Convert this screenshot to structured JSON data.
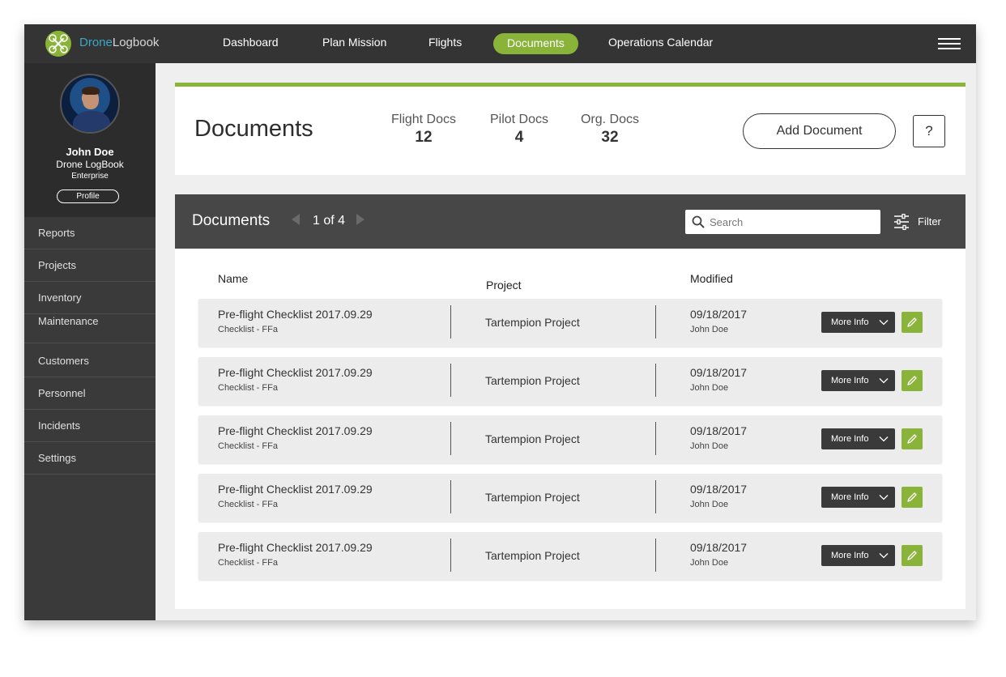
{
  "nav": {
    "brand_part1": "Drone",
    "brand_part2": "Logbook",
    "links": [
      {
        "label": "Dashboard",
        "active": false
      },
      {
        "label": "Plan Mission",
        "active": false
      },
      {
        "label": "Flights",
        "active": false
      },
      {
        "label": "Documents",
        "active": true
      },
      {
        "label": "Operations Calendar",
        "active": false
      }
    ],
    "menu_icon": "hamburger-icon"
  },
  "user": {
    "name": "John Doe",
    "org": "Drone LogBook",
    "plan": "Enterprise",
    "profile_label": "Profile"
  },
  "sidebar": {
    "items": [
      {
        "label": "Reports"
      },
      {
        "label": "Projects"
      },
      {
        "label": "Inventory"
      },
      {
        "label": "Maintenance"
      },
      {
        "label": "Customers"
      },
      {
        "label": "Personnel"
      },
      {
        "label": "Incidents"
      },
      {
        "label": "Settings"
      }
    ]
  },
  "header": {
    "title": "Documents",
    "stats": [
      {
        "label": "Flight Docs",
        "value": "12"
      },
      {
        "label": "Pilot Docs",
        "value": "4"
      },
      {
        "label": "Org. Docs",
        "value": "32"
      }
    ],
    "add_label": "Add Document",
    "help_label": "?"
  },
  "docs": {
    "title": "Documents",
    "pager": "1 of 4",
    "search_placeholder": "Search",
    "filter_label": "Filter",
    "columns": {
      "name": "Name",
      "project": "Project",
      "modified": "Modified"
    },
    "rows": [
      {
        "name": "Pre-flight Checklist 2017.09.29",
        "type": "Checklist - FFa",
        "project": "Tartempion Project",
        "date": "09/18/2017",
        "by": "John Doe",
        "more": "More Info"
      },
      {
        "name": "Pre-flight Checklist 2017.09.29",
        "type": "Checklist - FFa",
        "project": "Tartempion Project",
        "date": "09/18/2017",
        "by": "John Doe",
        "more": "More Info"
      },
      {
        "name": "Pre-flight Checklist 2017.09.29",
        "type": "Checklist - FFa",
        "project": "Tartempion Project",
        "date": "09/18/2017",
        "by": "John Doe",
        "more": "More Info"
      },
      {
        "name": "Pre-flight Checklist 2017.09.29",
        "type": "Checklist - FFa",
        "project": "Tartempion Project",
        "date": "09/18/2017",
        "by": "John Doe",
        "more": "More Info"
      },
      {
        "name": "Pre-flight Checklist 2017.09.29",
        "type": "Checklist - FFa",
        "project": "Tartempion Project",
        "date": "09/18/2017",
        "by": "John Doe",
        "more": "More Info"
      }
    ]
  },
  "colors": {
    "accent": "#8ab33a",
    "nav_bg": "#343434",
    "sidebar_bg": "#3a3a3a",
    "brand_blue": "#3aa7c8"
  }
}
